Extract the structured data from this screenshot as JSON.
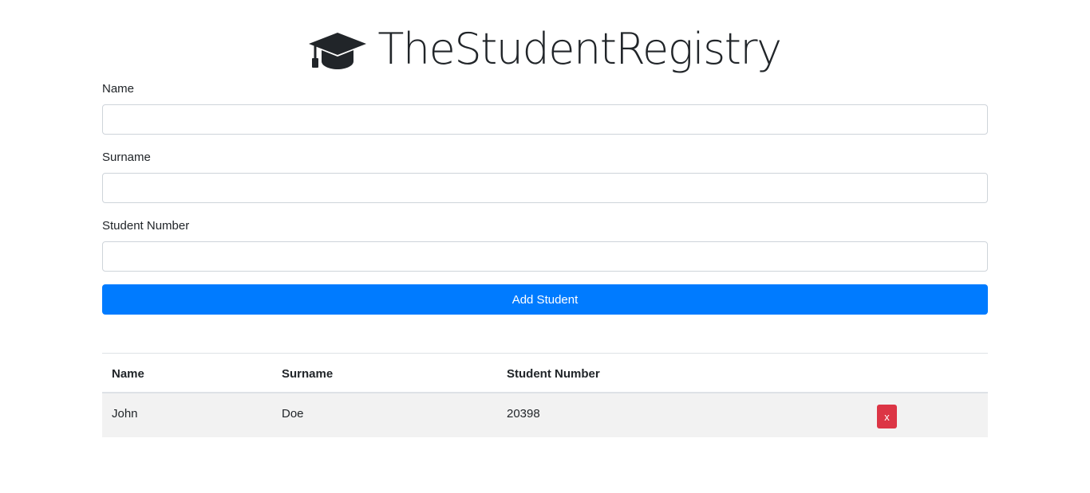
{
  "header": {
    "title": "TheStudentRegistry",
    "icon": "graduation-cap-icon"
  },
  "form": {
    "name_label": "Name",
    "name_value": "",
    "surname_label": "Surname",
    "surname_value": "",
    "student_number_label": "Student Number",
    "student_number_value": "",
    "add_button_label": "Add Student"
  },
  "table": {
    "columns": [
      "Name",
      "Surname",
      "Student Number"
    ],
    "rows": [
      {
        "name": "John",
        "surname": "Doe",
        "student_number": "20398",
        "delete_label": "x"
      }
    ]
  },
  "colors": {
    "primary": "#007bff",
    "danger": "#dc3545",
    "row_background": "#f2f2f2"
  }
}
